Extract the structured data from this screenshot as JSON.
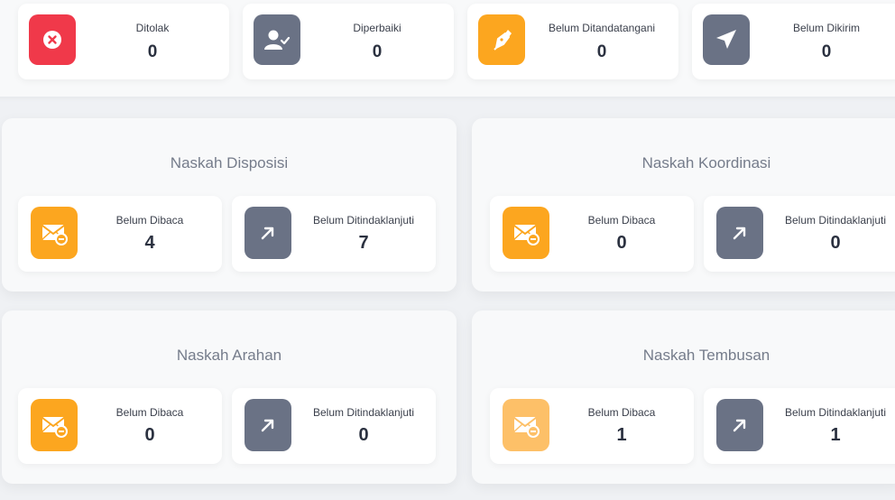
{
  "top_stats": [
    {
      "label": "Ditolak",
      "value": "0",
      "icon": "x-circle-icon",
      "color": "#f0394a"
    },
    {
      "label": "Diperbaiki",
      "value": "0",
      "icon": "user-check-icon",
      "color": "#6a7285"
    },
    {
      "label": "Belum Ditandatangani",
      "value": "0",
      "icon": "pen-icon",
      "color": "#fca61f"
    },
    {
      "label": "Belum Dikirim",
      "value": "0",
      "icon": "send-icon",
      "color": "#6a7285"
    }
  ],
  "sections": [
    {
      "title": "Naskah Disposisi",
      "unread": {
        "label": "Belum Dibaca",
        "value": "4",
        "icon": "mail-minus-icon"
      },
      "pending": {
        "label": "Belum Ditindaklanjuti",
        "value": "7",
        "icon": "arrow-up-right-icon"
      }
    },
    {
      "title": "Naskah Koordinasi",
      "unread": {
        "label": "Belum Dibaca",
        "value": "0",
        "icon": "mail-minus-icon"
      },
      "pending": {
        "label": "Belum Ditindaklanjuti",
        "value": "0",
        "icon": "arrow-up-right-icon"
      }
    },
    {
      "title": "Naskah Arahan",
      "unread": {
        "label": "Belum Dibaca",
        "value": "0",
        "icon": "mail-minus-icon"
      },
      "pending": {
        "label": "Belum Ditindaklanjuti",
        "value": "0",
        "icon": "arrow-up-right-icon"
      }
    },
    {
      "title": "Naskah Tembusan",
      "unread": {
        "label": "Belum Dibaca",
        "value": "1",
        "icon": "mail-minus-icon"
      },
      "pending": {
        "label": "Belum Ditindaklanjuti",
        "value": "1",
        "icon": "arrow-up-right-icon"
      }
    }
  ]
}
